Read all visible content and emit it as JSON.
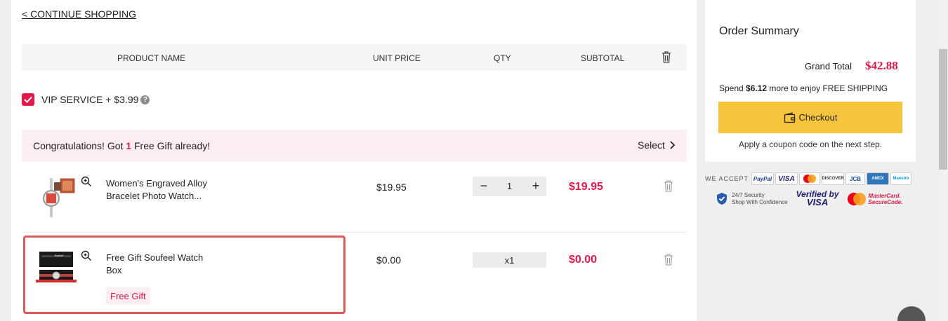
{
  "nav": {
    "continue_label": "< CONTINUE SHOPPING"
  },
  "table_header": {
    "product_name": "PRODUCT NAME",
    "unit_price": "UNIT PRICE",
    "qty": "QTY",
    "subtotal": "SUBTOTAL",
    "delete_icon": "trash-icon"
  },
  "vip": {
    "checked": true,
    "label": "VIP SERVICE + $3.99",
    "help_icon": "question-icon"
  },
  "gift_banner": {
    "prefix": "Congratulations! Got ",
    "count": "1",
    "suffix": " Free Gift already!",
    "select_label": "Select"
  },
  "items": [
    {
      "name": "Women's Engraved Alloy Bracelet Photo Watch...",
      "unit_price": "$19.95",
      "qty": "1",
      "subtotal": "$19.95",
      "type": "stepper"
    },
    {
      "name": "Free Gift Soufeel Watch Box",
      "unit_price": "$0.00",
      "qty": "x1",
      "subtotal": "$0.00",
      "type": "fixed",
      "tag": "Free Gift"
    }
  ],
  "summary": {
    "title": "Order Summary",
    "grand_total_label": "Grand Total",
    "grand_total": "$42.88",
    "spend_prefix": "Spend ",
    "spend_amount": "$6.12",
    "spend_suffix": " more to enjoy FREE SHIPPING",
    "checkout_label": "Checkout",
    "coupon_note": "Apply a coupon code on the next step."
  },
  "payment": {
    "accept_label": "WE ACCEPT",
    "cards": [
      "PayPal",
      "VISA",
      "MC",
      "DISCOVER",
      "JCB",
      "AMEX",
      "Maestro"
    ],
    "security_line1": "24/7 Security",
    "security_line2": "Shop With Confidence",
    "vbv_line1": "Verified by",
    "vbv_line2": "VISA",
    "mcsc_line1": "MasterCard.",
    "mcsc_line2": "SecureCode."
  },
  "colors": {
    "accent": "#e6184a",
    "checkout": "#f7c53c",
    "highlight": "#e05a57"
  }
}
